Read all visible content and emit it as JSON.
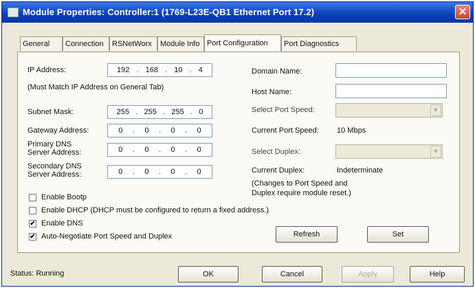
{
  "window": {
    "title": "Module Properties: Controller:1 (1769-L23E-QB1 Ethernet Port 17.2)"
  },
  "tabs": [
    "General",
    "Connection",
    "RSNetWorx",
    "Module Info",
    "Port Configuration",
    "Port Diagnostics"
  ],
  "active_tab": "Port Configuration",
  "ip": {
    "label": "IP Address:",
    "octets": [
      "192",
      "168",
      "10",
      "4"
    ],
    "note": "(Must Match IP Address on General Tab)"
  },
  "subnet": {
    "label": "Subnet Mask:",
    "octets": [
      "255",
      "255",
      "255",
      "0"
    ]
  },
  "gateway": {
    "label": "Gateway Address:",
    "octets": [
      "0",
      "0",
      "0",
      "0"
    ]
  },
  "dns1": {
    "label_line1": "Primary DNS",
    "label_line2": "Server Address:",
    "octets": [
      "0",
      "0",
      "0",
      "0"
    ]
  },
  "dns2": {
    "label_line1": "Secondary DNS",
    "label_line2": "Server Address:",
    "octets": [
      "0",
      "0",
      "0",
      "0"
    ]
  },
  "right": {
    "domain_label": "Domain Name:",
    "domain_value": "",
    "host_label": "Host Name:",
    "host_value": "",
    "port_speed_label": "Select Port Speed:",
    "current_speed_label": "Current Port Speed:",
    "current_speed_value": "10 Mbps",
    "duplex_label": "Select Duplex:",
    "current_duplex_label": "Current Duplex:",
    "current_duplex_value": "Indeterminate",
    "note_line1": "(Changes to Port Speed and",
    "note_line2": "Duplex require module reset.)"
  },
  "checkboxes": {
    "bootp": {
      "label": "Enable Bootp",
      "checked": false
    },
    "dhcp": {
      "label": "Enable DHCP",
      "note": "(DHCP must be configured to return a fixed address.)",
      "checked": false
    },
    "dns": {
      "label": "Enable DNS",
      "checked": true
    },
    "autoneg": {
      "label": "Auto-Negotiate Port Speed and Duplex",
      "checked": true
    }
  },
  "buttons": {
    "refresh": "Refresh",
    "set": "Set",
    "ok": "OK",
    "cancel": "Cancel",
    "apply": "Apply",
    "help": "Help"
  },
  "status": {
    "label": "Status:",
    "value": "Running"
  }
}
